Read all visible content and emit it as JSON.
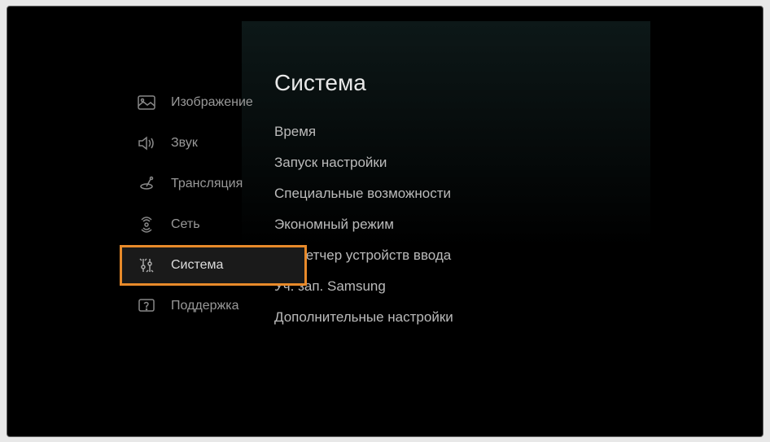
{
  "sidebar": {
    "items": [
      {
        "label": "Изображение",
        "icon": "picture"
      },
      {
        "label": "Звук",
        "icon": "sound"
      },
      {
        "label": "Трансляция",
        "icon": "broadcast"
      },
      {
        "label": "Сеть",
        "icon": "network"
      },
      {
        "label": "Система",
        "icon": "system",
        "active": true
      },
      {
        "label": "Поддержка",
        "icon": "support"
      }
    ]
  },
  "content": {
    "title": "Система",
    "items": [
      "Время",
      "Запуск настройки",
      "Специальные возможности",
      "Экономный режим",
      "Диспетчер устройств ввода",
      "Уч. зап. Samsung",
      "Дополнительные настройки"
    ]
  }
}
